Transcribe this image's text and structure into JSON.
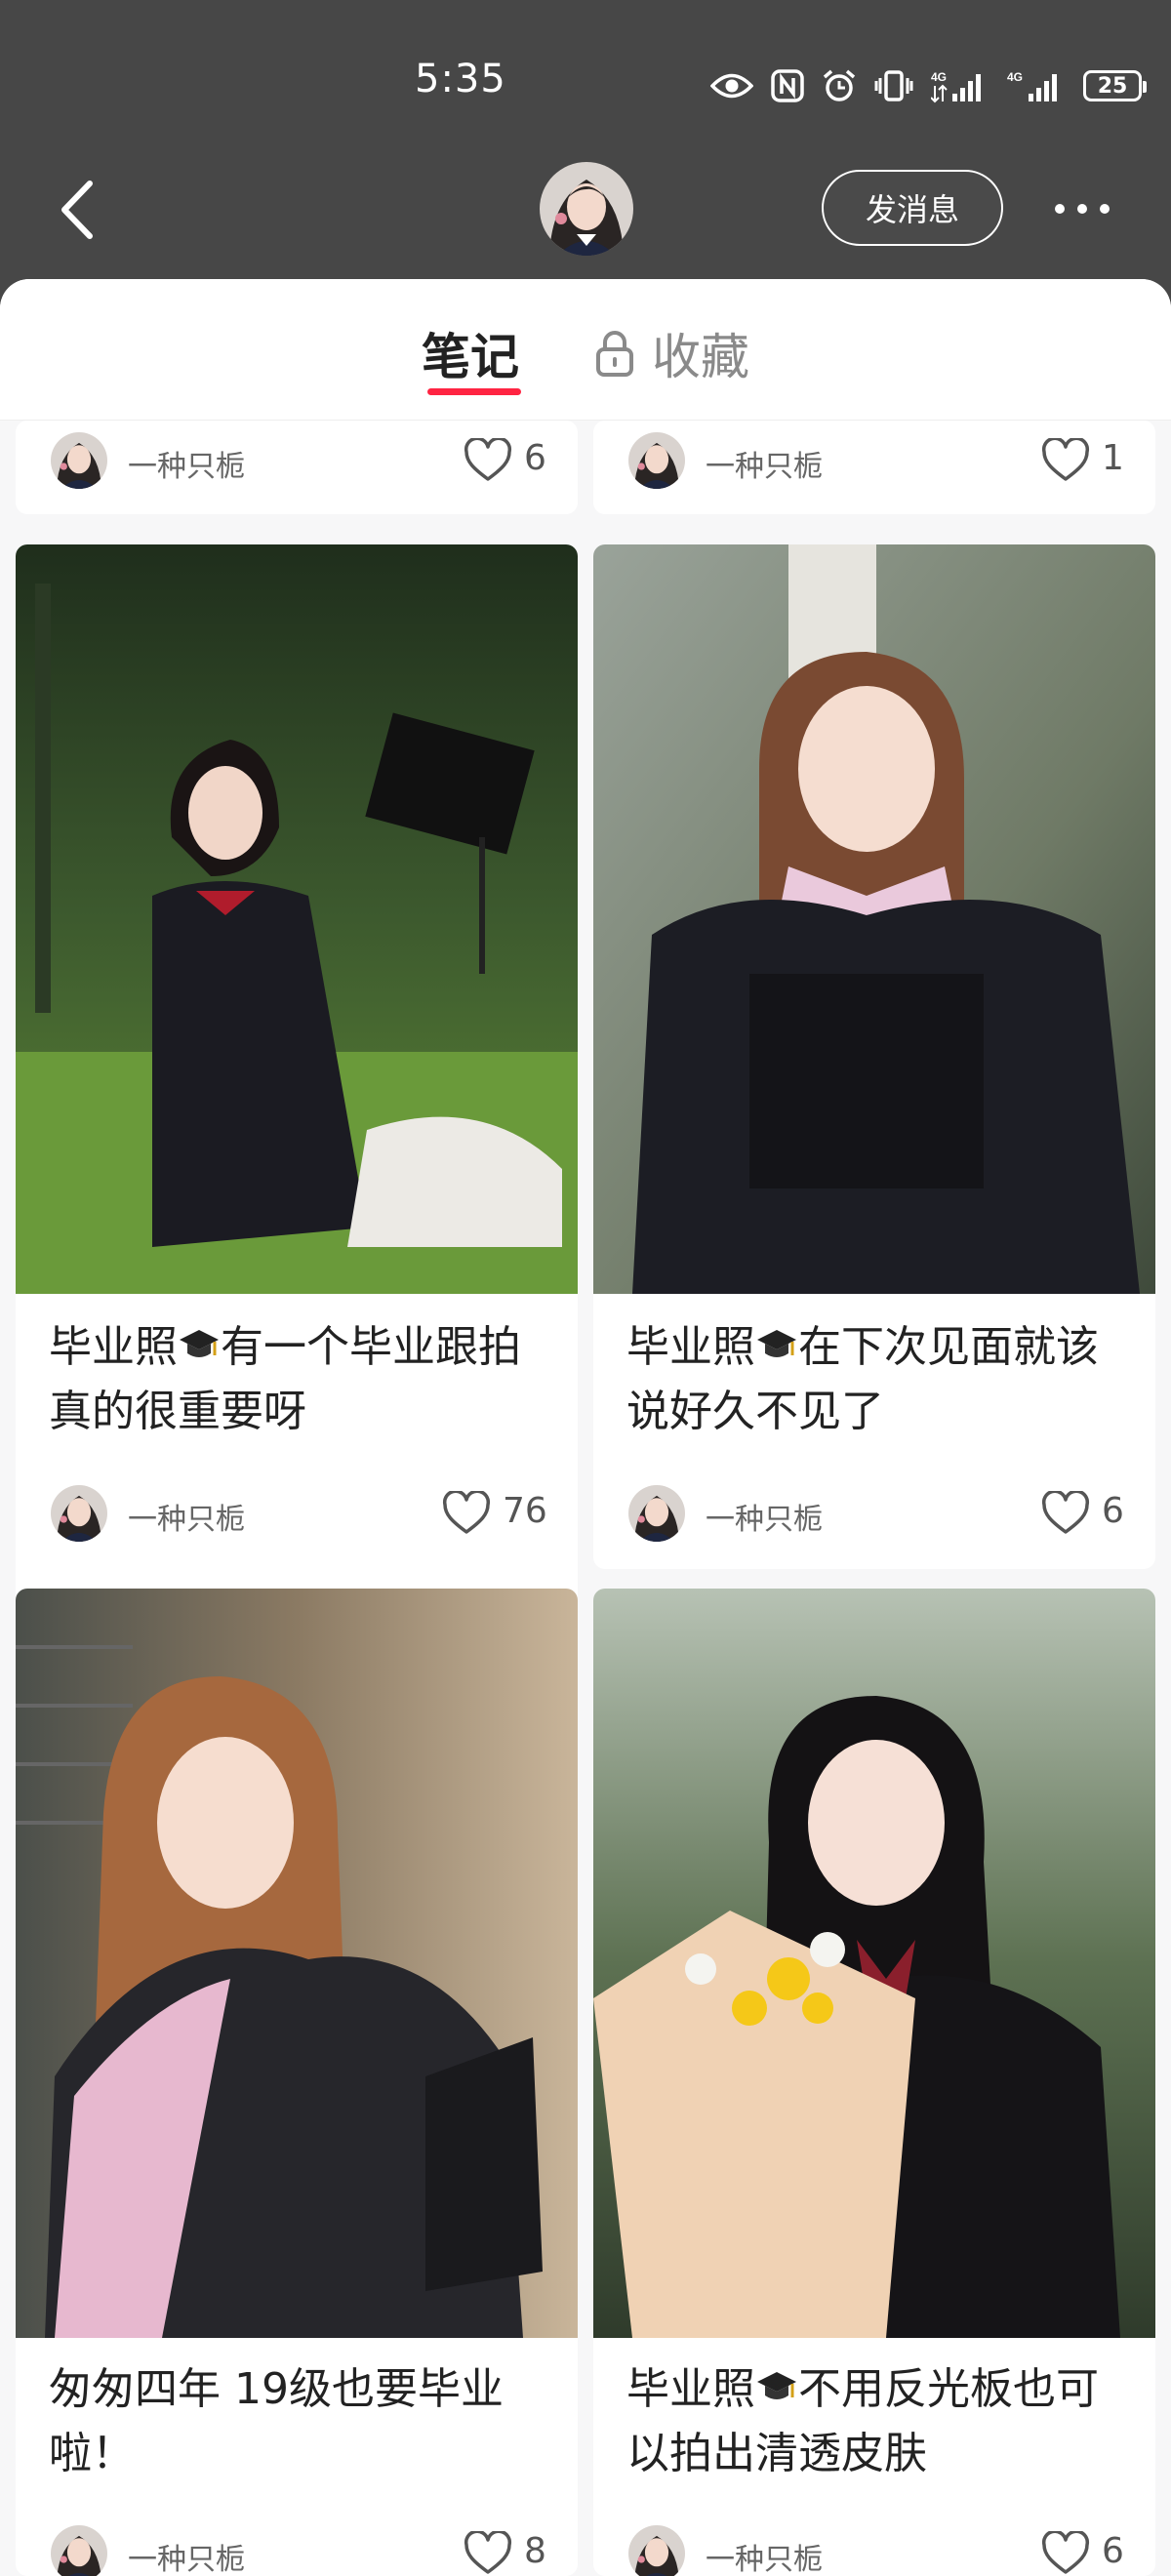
{
  "status_bar": {
    "time": "5:35",
    "network_1": "4G",
    "network_2": "4G",
    "battery": "25",
    "icons": [
      "eye-icon",
      "nfc-icon",
      "alarm-icon",
      "vibrate-icon",
      "signal-icon",
      "signal-icon",
      "battery-icon"
    ]
  },
  "nav": {
    "back_icon": "chevron-left-icon",
    "message_label": "发消息",
    "more_icon": "more-dots-icon"
  },
  "tabs": {
    "notes_label": "笔记",
    "favorites_label": "收藏",
    "favorites_icon": "lock-icon",
    "active_color": "#ff2442"
  },
  "feed": {
    "partial_top": [
      {
        "author": "一种只栀",
        "likes": "6"
      },
      {
        "author": "一种只栀",
        "likes": "1"
      }
    ],
    "cards": [
      {
        "title": "毕业照🎓有一个毕业跟拍真的很重要呀",
        "title_a": "毕业照",
        "title_b": "有一个毕业跟拍真的很重要呀",
        "author": "一种只栀",
        "likes": "76"
      },
      {
        "title": "毕业照🎓在下次见面就该说好久不见了",
        "title_a": "毕业照",
        "title_b": "在下次见面就该说好久不见了",
        "author": "一种只栀",
        "likes": "6"
      },
      {
        "title": "匆匆四年 19级也要毕业啦！",
        "title_a": "",
        "title_b": "匆匆四年 19级也要毕业啦！",
        "author": "一种只栀",
        "likes": "8"
      },
      {
        "title": "毕业照🎓不用反光板也可以拍出清透皮肤",
        "title_a": "毕业照",
        "title_b": "不用反光板也可以拍出清透皮肤",
        "author": "一种只栀",
        "likes": "6"
      }
    ]
  }
}
